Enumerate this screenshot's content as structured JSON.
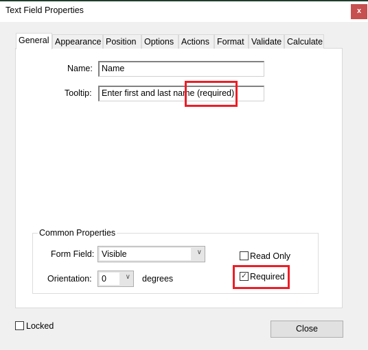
{
  "window": {
    "title": "Text Field Properties",
    "close_label": "x"
  },
  "tabs": [
    {
      "label": "General",
      "active": true
    },
    {
      "label": "Appearance"
    },
    {
      "label": "Position"
    },
    {
      "label": "Options"
    },
    {
      "label": "Actions"
    },
    {
      "label": "Format"
    },
    {
      "label": "Validate"
    },
    {
      "label": "Calculate"
    }
  ],
  "general": {
    "name_label": "Name:",
    "name_value": "Name",
    "tooltip_label": "Tooltip:",
    "tooltip_value": "Enter first and last name (required)"
  },
  "common": {
    "legend": "Common Properties",
    "form_field_label": "Form Field:",
    "form_field_value": "Visible",
    "orientation_label": "Orientation:",
    "orientation_value": "0",
    "degrees_label": "degrees",
    "read_only_label": "Read Only",
    "read_only_checked": false,
    "required_label": "Required",
    "required_checked": true
  },
  "footer": {
    "locked_label": "Locked",
    "locked_checked": false,
    "close_label": "Close"
  },
  "colors": {
    "highlight": "#ee1c25",
    "close_button": "#c75050"
  }
}
